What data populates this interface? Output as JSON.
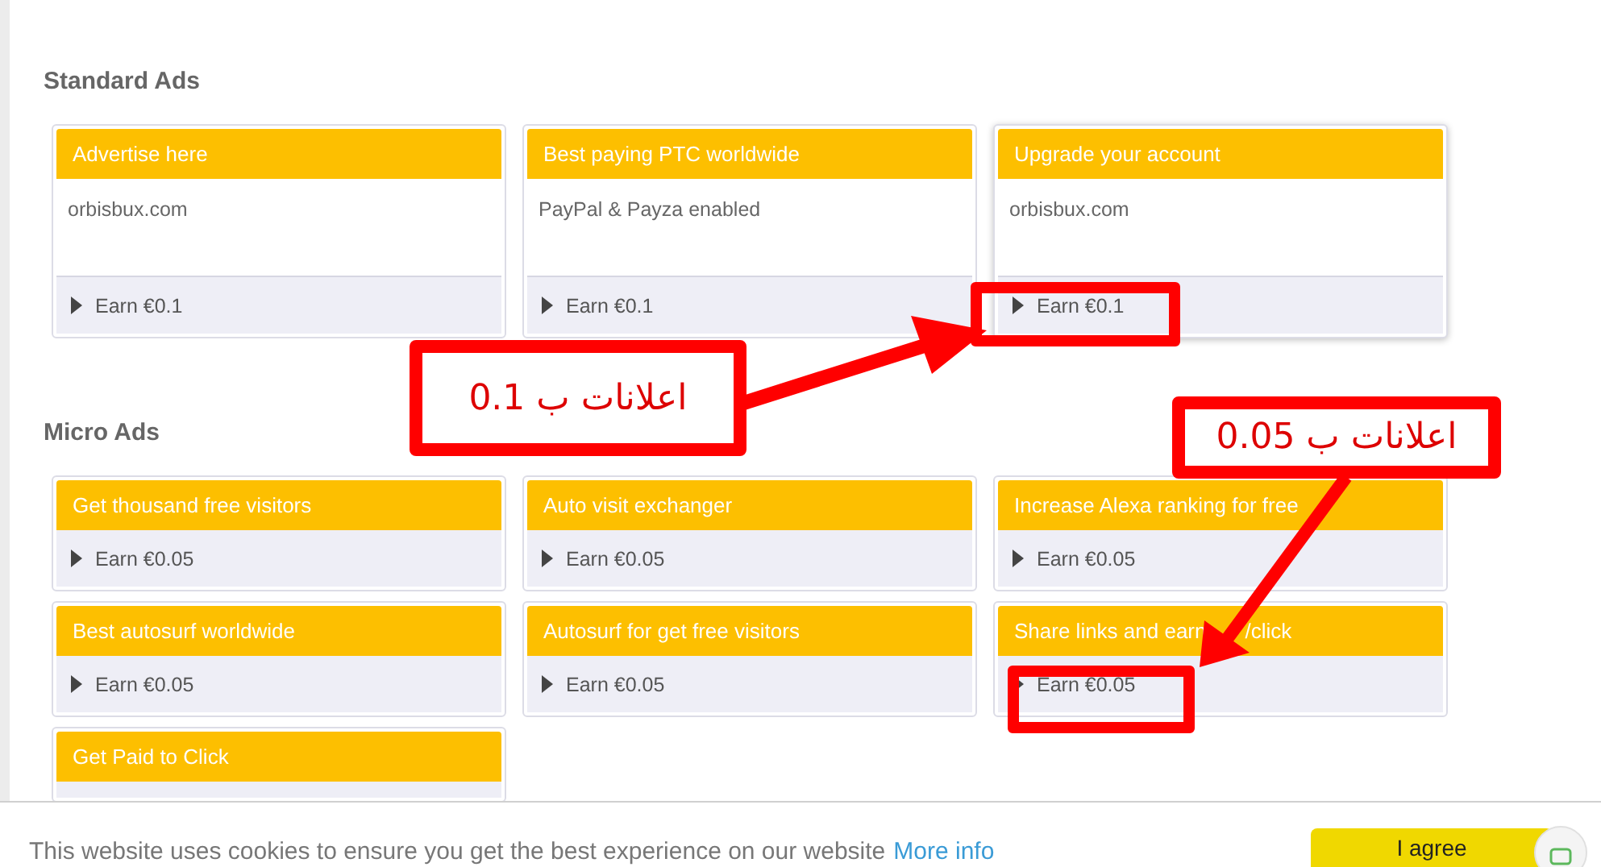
{
  "sections": [
    {
      "title": "Standard Ads",
      "kind": "standard",
      "ads": [
        {
          "title": "Advertise here",
          "description": "orbisbux.com",
          "earn": "Earn €0.1"
        },
        {
          "title": "Best paying PTC worldwide",
          "description": "PayPal & Payza enabled",
          "earn": "Earn €0.1"
        },
        {
          "title": "Upgrade your account",
          "description": "orbisbux.com",
          "earn": "Earn €0.1"
        }
      ]
    },
    {
      "title": "Micro Ads",
      "kind": "micro",
      "ads": [
        {
          "title": "Get thousand free visitors",
          "earn": "Earn €0.05"
        },
        {
          "title": "Auto visit exchanger",
          "earn": "Earn €0.05"
        },
        {
          "title": "Increase Alexa ranking for free",
          "earn": "Earn €0.05"
        },
        {
          "title": "Best autosurf worldwide",
          "earn": "Earn €0.05"
        },
        {
          "title": "Autosurf for get free visitors",
          "earn": "Earn €0.05"
        },
        {
          "title": "Share links and earn",
          "title_tail": "/click",
          "earn": "Earn €0.05"
        },
        {
          "title": "Get Paid to Click"
        }
      ]
    }
  ],
  "annotations": [
    {
      "text": "اعلانات ب 0.1"
    },
    {
      "text": "اعلانات ب 0.05"
    }
  ],
  "cookie_bar": {
    "message": "This website uses cookies to ensure you get the best experience on our website",
    "link": "More info",
    "button": "I agree"
  }
}
